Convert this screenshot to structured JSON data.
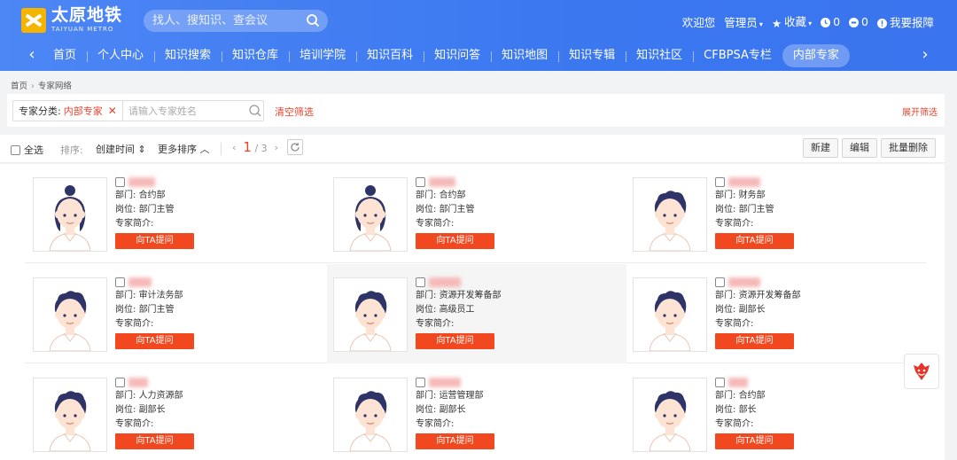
{
  "header": {
    "logo_cn": "太原地铁",
    "logo_en": "TAIYUAN METRO",
    "search_placeholder": "找人、搜知识、查会议",
    "welcome": "欢迎您",
    "user": "管理员",
    "favorites": "收藏",
    "count_a": "0",
    "count_b": "0",
    "report": "我要报障"
  },
  "nav": {
    "items": [
      "首页",
      "个人中心",
      "知识搜索",
      "知识仓库",
      "培训学院",
      "知识百科",
      "知识问答",
      "知识地图",
      "知识专辑",
      "知识社区",
      "CFBPSA专栏",
      "内部专家"
    ],
    "active_index": 11
  },
  "breadcrumb": {
    "home": "首页",
    "current": "专家网络"
  },
  "filter": {
    "tag_label": "专家分类:",
    "tag_value": "内部专家",
    "name_placeholder": "请输入专家姓名",
    "clear": "清空筛选",
    "expand": "展开筛选"
  },
  "toolbar": {
    "select_all": "全选",
    "sort_label": "排序:",
    "sort_time": "创建时间",
    "sort_more": "更多排序",
    "page_current": "1",
    "page_total": "/ 3",
    "new": "新建",
    "edit": "编辑",
    "batch_delete": "批量删除"
  },
  "card_labels": {
    "dept": "部门:",
    "post": "岗位:",
    "intro": "专家简介:",
    "ask": "向TA提问"
  },
  "experts": [
    {
      "dept": "合约部",
      "post": "部门主管",
      "gender": "female"
    },
    {
      "dept": "合约部",
      "post": "部门主管",
      "gender": "female"
    },
    {
      "dept": "财务部",
      "post": "部门主管",
      "gender": "male"
    },
    {
      "dept": "审计法务部",
      "post": "部门主管",
      "gender": "male"
    },
    {
      "dept": "资源开发筹备部",
      "post": "高级员工",
      "gender": "male"
    },
    {
      "dept": "资源开发筹备部",
      "post": "副部长",
      "gender": "male"
    },
    {
      "dept": "人力资源部",
      "post": "副部长",
      "gender": "male"
    },
    {
      "dept": "运营管理部",
      "post": "副部长",
      "gender": "male"
    },
    {
      "dept": "合约部",
      "post": "部长",
      "gender": "male"
    }
  ],
  "colors": {
    "header": "#3b78f0",
    "accent": "#e6442e",
    "ask_button": "#f2481f",
    "hair": "#2f3468",
    "skin": "#fde3d3"
  }
}
